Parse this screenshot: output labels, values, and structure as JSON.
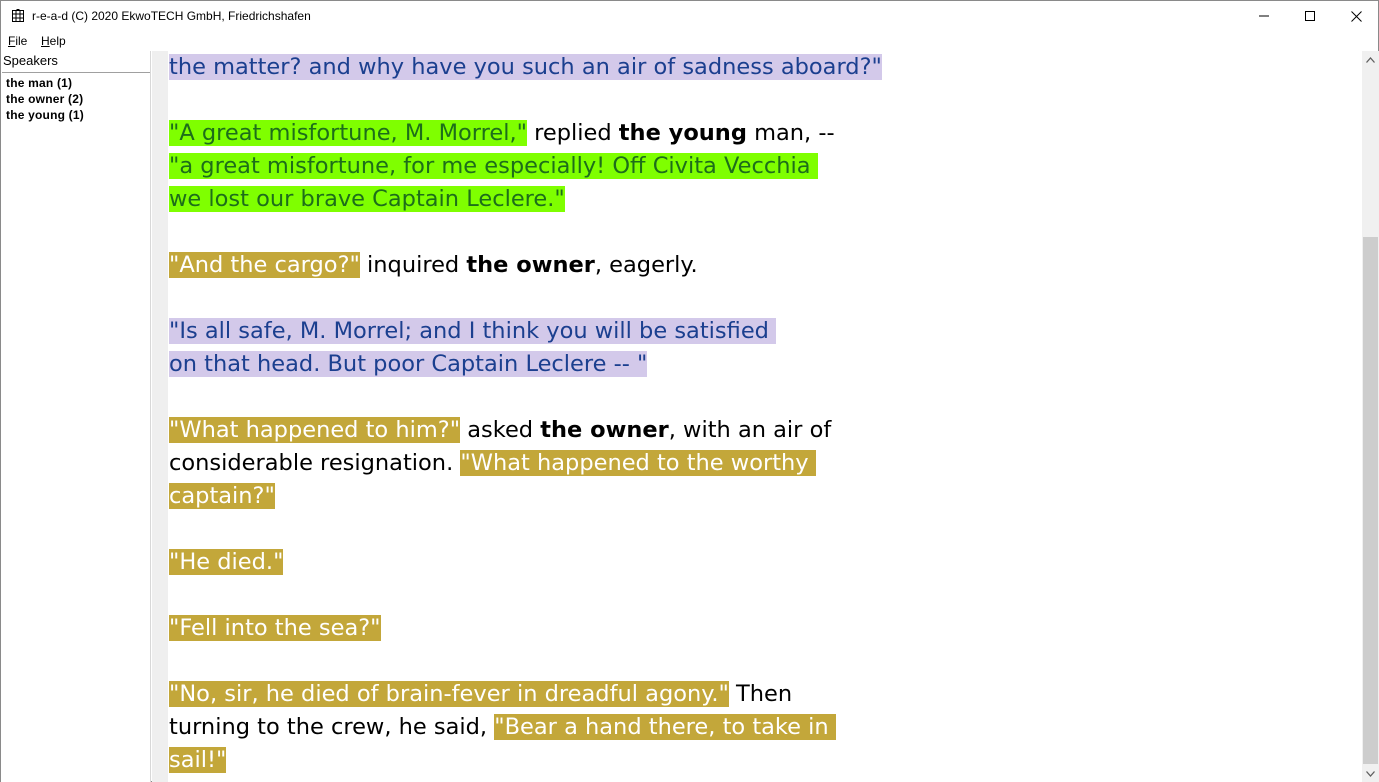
{
  "window": {
    "title": "r-e-a-d (C) 2020 EkwoTECH GmbH, Friedrichshafen",
    "app_icon": "book-grid-icon",
    "controls": {
      "minimize": "minimize-icon",
      "maximize": "maximize-icon",
      "close": "close-icon"
    }
  },
  "menu": {
    "file_first": "F",
    "file_rest": "ile",
    "help_first": "H",
    "help_rest": "elp"
  },
  "sidebar": {
    "header": "Speakers",
    "items": [
      {
        "label": "the man (1)"
      },
      {
        "label": "the owner (2)"
      },
      {
        "label": "the young (1)"
      }
    ]
  },
  "colors": {
    "lavender_highlight": "#d3c9ea",
    "lavender_text": "#1b3f8f",
    "green_highlight": "#7fff00",
    "green_text": "#1d6e1a",
    "gold_highlight": "#c3a73a",
    "gold_text": "#ffffff"
  },
  "document": {
    "l1": "the matter? and why have you such an air of sadness aboard?\"",
    "l2a": "\"A great misfortune, M. Morrel,\"",
    "l2b": " replied ",
    "l2c": "the young",
    "l2d": " man, --",
    "l3": "\"a great misfortune, for me especially! Off Civita Vecchia ",
    "l4": "we lost our brave Captain Leclere.\"",
    "l5a": "\"And the cargo?\"",
    "l5b": " inquired ",
    "l5c": "the owner",
    "l5d": ", eagerly.",
    "l6": "\"Is all safe, M. Morrel; and I think you will be satisfied ",
    "l7": "on that head. But poor Captain Leclere -- \"",
    "l8a": "\"What happened to him?\"",
    "l8b": " asked ",
    "l8c": "the owner",
    "l8d": ", with an air of",
    "l9a": "considerable resignation. ",
    "l9b": "\"What happened to the worthy ",
    "l10": "captain?\"",
    "l11": "\"He died.\"",
    "l12": "\"Fell into the sea?\"",
    "l13a": "\"No, sir, he died of brain-fever in dreadful agony.\"",
    "l13b": " Then",
    "l14a": "turning to the crew, he said, ",
    "l14b": "\"Bear a hand there, to take in ",
    "l15": "sail!\""
  }
}
